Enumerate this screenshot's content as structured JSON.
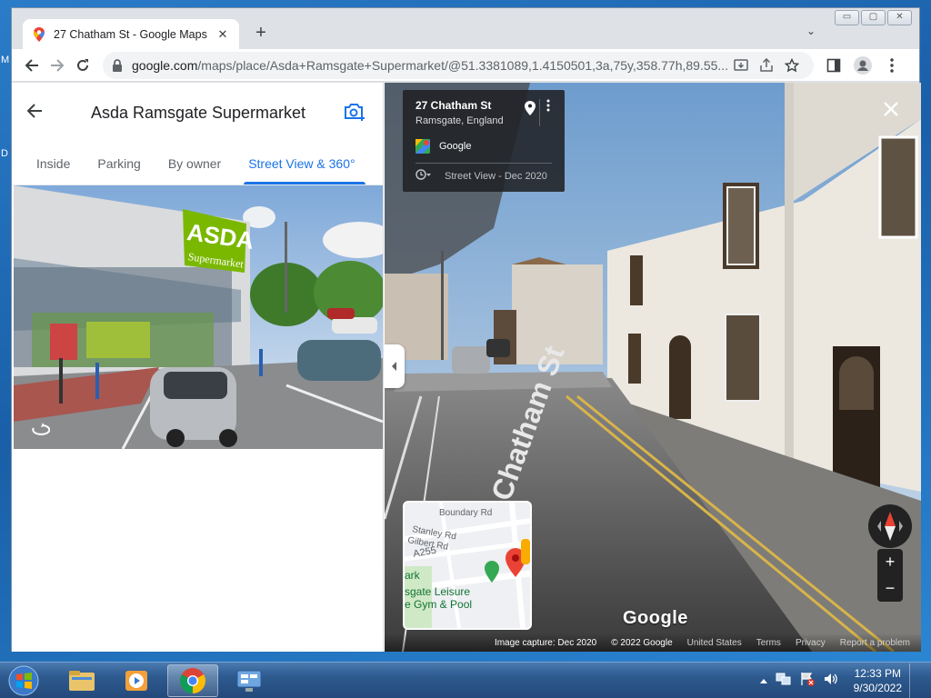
{
  "desktop": {
    "edge_labels": [
      "M",
      "D"
    ]
  },
  "browser": {
    "tab": {
      "title": "27 Chatham St - Google Maps",
      "close": "✕"
    },
    "new_tab": "+",
    "tab_menu": "⌄",
    "window_controls": {
      "minimize": "▭",
      "maximize": "▢",
      "close": "✕"
    },
    "url": {
      "host": "google.com",
      "path": "/maps/place/Asda+Ramsgate+Supermarket/@51.3381089,1.4150501,3a,75y,358.77h,89.55..."
    }
  },
  "panel": {
    "title": "Asda Ramsgate Supermarket",
    "tabs": [
      {
        "label": "Inside"
      },
      {
        "label": "Parking"
      },
      {
        "label": "By owner"
      },
      {
        "label": "Street View & 360°",
        "active": true
      }
    ],
    "thumb_signage": [
      "ASDA",
      "Supermarket"
    ]
  },
  "streetview": {
    "address": "27 Chatham St",
    "locality": "Ramsgate, England",
    "provider": "Google",
    "capture_label": "Street View - Dec 2020",
    "road_marking": "Chatham St",
    "watermark": "Google",
    "minimap": {
      "labels": [
        "Stanley Rd",
        "Gilbert Rd",
        "Boundary Rd",
        "A255",
        "ark",
        "sgate Leisure",
        "e Gym & Pool"
      ]
    },
    "footer": {
      "capture": "Image capture: Dec 2020",
      "copyright": "© 2022 Google",
      "links": [
        "United States",
        "Terms",
        "Privacy",
        "Report a problem"
      ]
    }
  },
  "taskbar": {
    "time": "12:33 PM",
    "date": "9/30/2022"
  },
  "colors": {
    "accent": "#1a73e8",
    "pin_red": "#ea4335",
    "asda_green": "#7ab800",
    "taskbar": "#2d5a8f"
  }
}
